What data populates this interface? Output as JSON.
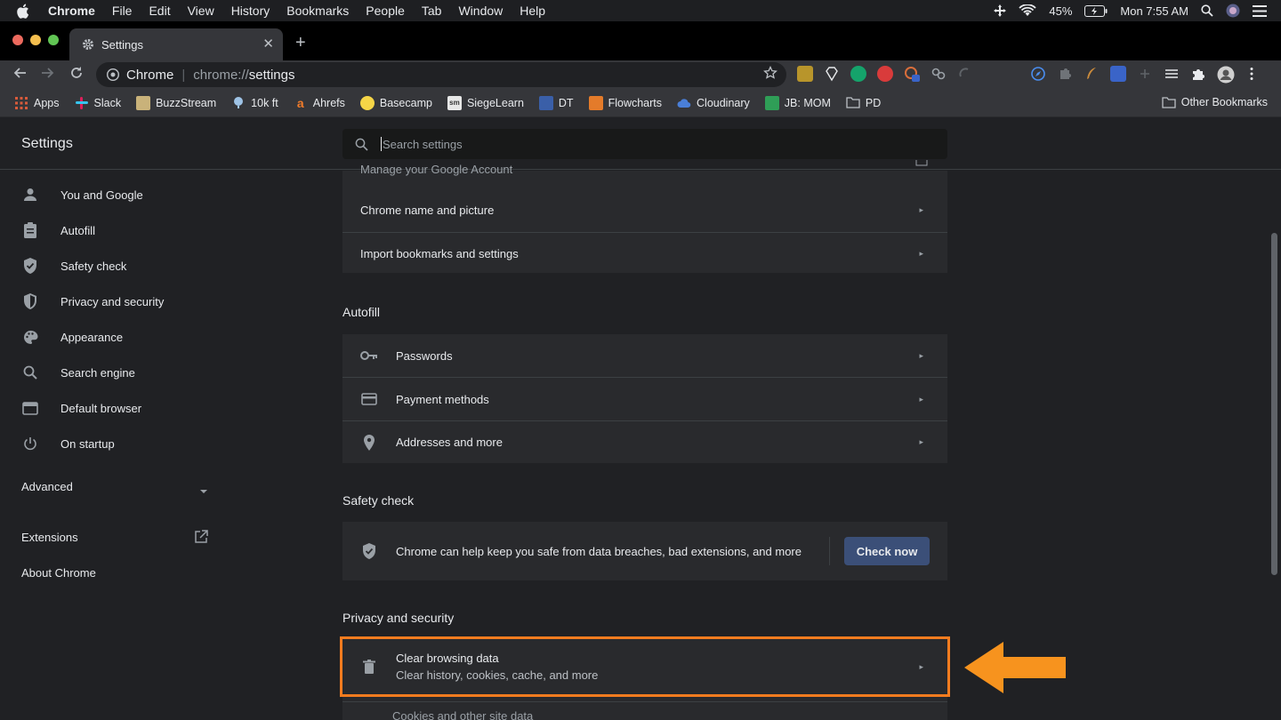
{
  "menubar": {
    "items": [
      "Chrome",
      "File",
      "Edit",
      "View",
      "History",
      "Bookmarks",
      "People",
      "Tab",
      "Window",
      "Help"
    ],
    "battery": "45%",
    "clock": "Mon 7:55 AM"
  },
  "tab": {
    "title": "Settings"
  },
  "omnibox": {
    "site": "Chrome",
    "scheme": "chrome://",
    "path": "settings"
  },
  "bookmarks": {
    "items": [
      "Apps",
      "Slack",
      "BuzzStream",
      "10k ft",
      "Ahrefs",
      "Basecamp",
      "SiegeLearn",
      "DT",
      "Flowcharts",
      "Cloudinary",
      "JB: MOM",
      "PD"
    ],
    "other": "Other Bookmarks"
  },
  "header": {
    "title": "Settings",
    "search_placeholder": "Search settings"
  },
  "nav": {
    "items": [
      "You and Google",
      "Autofill",
      "Safety check",
      "Privacy and security",
      "Appearance",
      "Search engine",
      "Default browser",
      "On startup"
    ],
    "advanced": "Advanced",
    "extensions": "Extensions",
    "about": "About Chrome"
  },
  "you_and_google": {
    "partial": "Manage your Google Account",
    "rows": [
      "Chrome name and picture",
      "Import bookmarks and settings"
    ]
  },
  "autofill": {
    "title": "Autofill",
    "rows": [
      "Passwords",
      "Payment methods",
      "Addresses and more"
    ]
  },
  "safety": {
    "title": "Safety check",
    "text": "Chrome can help keep you safe from data breaches, bad extensions, and more",
    "button": "Check now"
  },
  "privacy": {
    "title": "Privacy and security",
    "clear_title": "Clear browsing data",
    "clear_sub": "Clear history, cookies, cache, and more",
    "cookies": "Cookies and other site data"
  },
  "colors": {
    "highlight": "#f57c1f",
    "background": "#202124",
    "card": "#292a2d"
  }
}
